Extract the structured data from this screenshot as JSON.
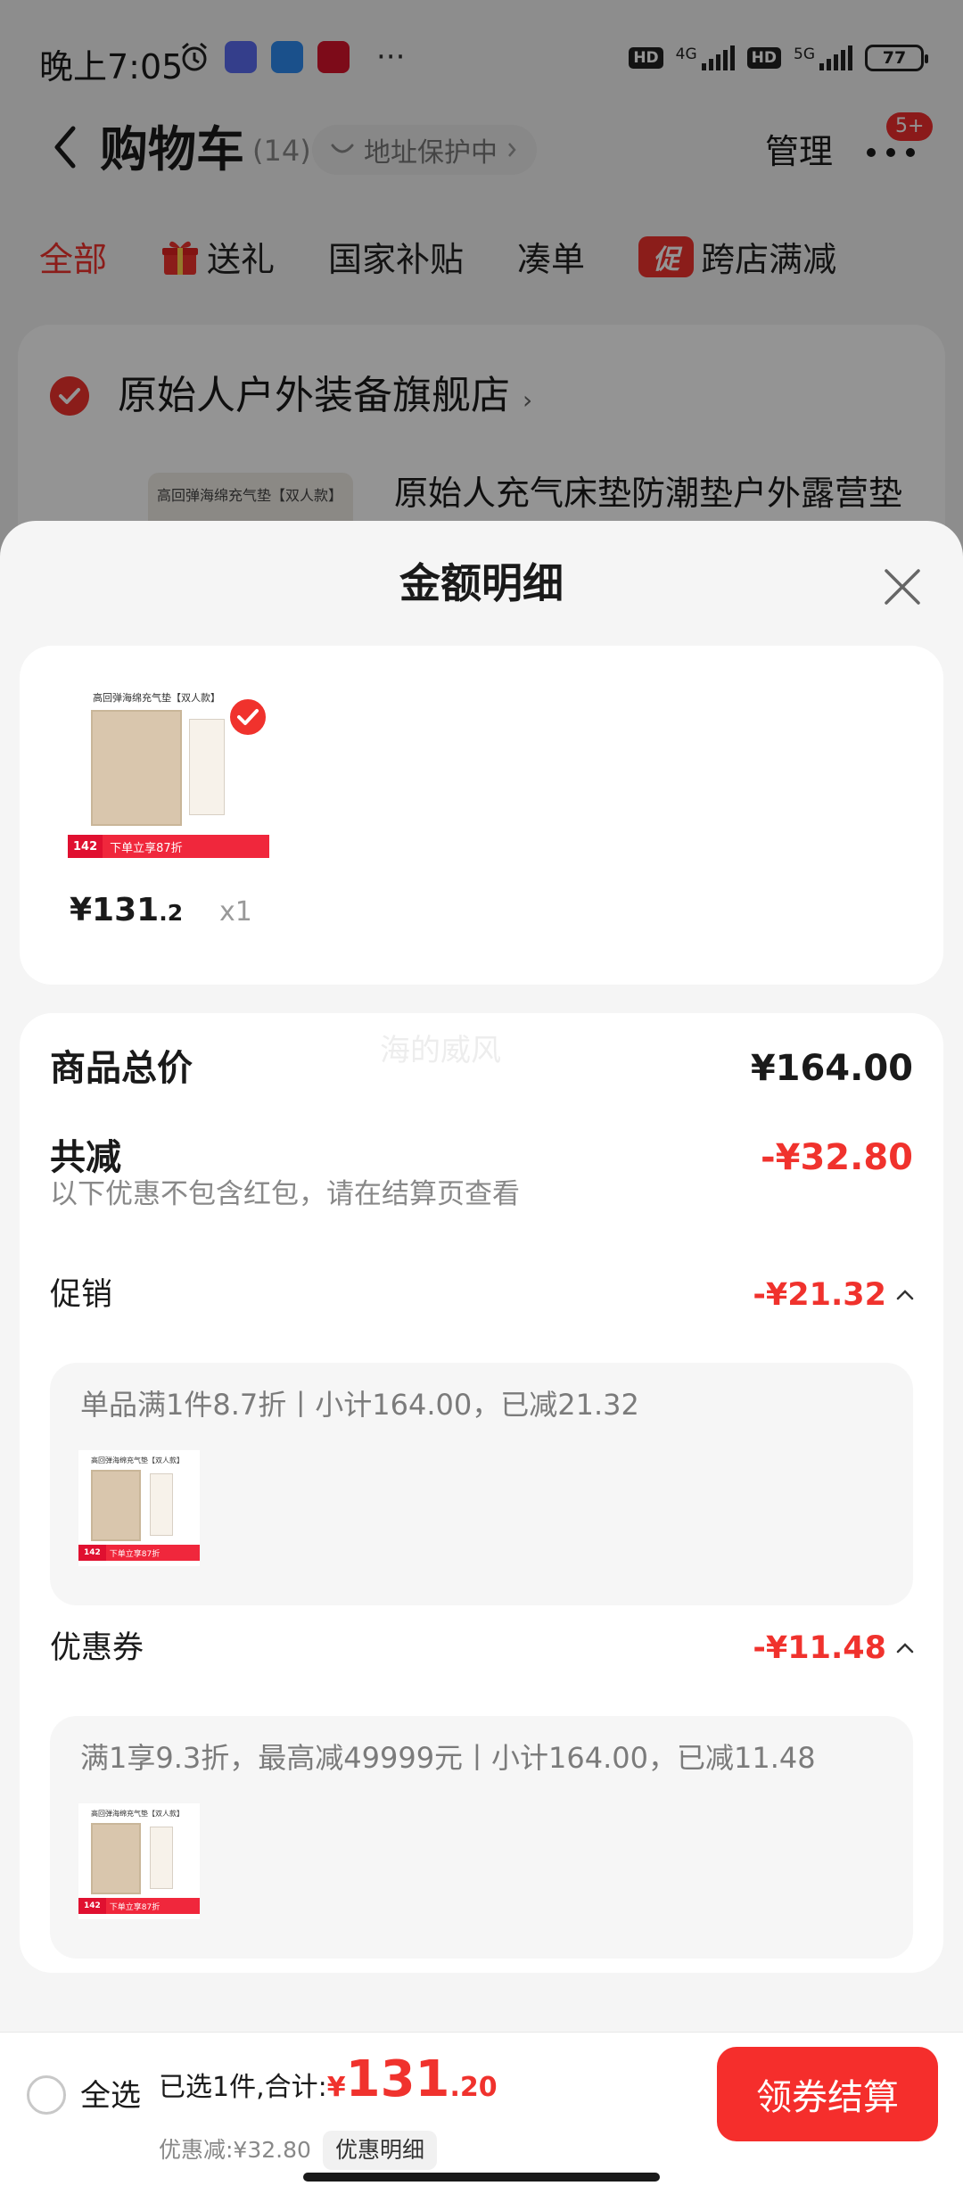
{
  "status_bar": {
    "time": "晚上7:05",
    "hd1": "HD",
    "net1": "4G",
    "hd2": "HD",
    "net2": "5G",
    "battery": "77"
  },
  "cart": {
    "title": "购物车",
    "count": "(14)",
    "address_protect": "地址保护中",
    "manage": "管理",
    "badge": "5+",
    "tabs": [
      "全部",
      "送礼",
      "国家补贴",
      "凑单",
      "跨店满减"
    ],
    "promo_tag_char": "促",
    "store_name": "原始人户外装备旗舰店",
    "product_name": "原始人充气床垫防潮垫户外露营垫",
    "thumb_caption": "高回弹海绵充气垫【双人款】"
  },
  "sheet": {
    "title": "金额明细",
    "product": {
      "price_int": "¥131",
      "price_dec": ".2",
      "qty": "x1",
      "thumb_price_tag": "142",
      "thumb_stripe_text": "下单立享87折"
    },
    "details": {
      "total_label": "商品总价",
      "total_value": "¥164.00",
      "reduce_label": "共减",
      "reduce_value": "-¥32.80",
      "note": "以下优惠不包含红包，请在结算页查看",
      "promo_label": "促销",
      "promo_value": "-¥21.32",
      "promo_desc": "单品满1件8.7折丨小计164.00，已减21.32",
      "coupon_label": "优惠券",
      "coupon_value": "-¥11.48",
      "coupon_desc": "满1享9.3折，最高减49999元丨小计164.00，已减11.48"
    },
    "watermark": "海的威风"
  },
  "footer": {
    "select_all": "全选",
    "summary_label": "已选1件,合计:",
    "currency": "¥",
    "total_int": "131",
    "total_dec": ".20",
    "discount": "优惠减:¥32.80",
    "detail_chip": "优惠明细",
    "checkout": "领券结算"
  },
  "colors": {
    "accent": "#f0322d",
    "overlay": "rgba(0,0,0,0.42)"
  }
}
